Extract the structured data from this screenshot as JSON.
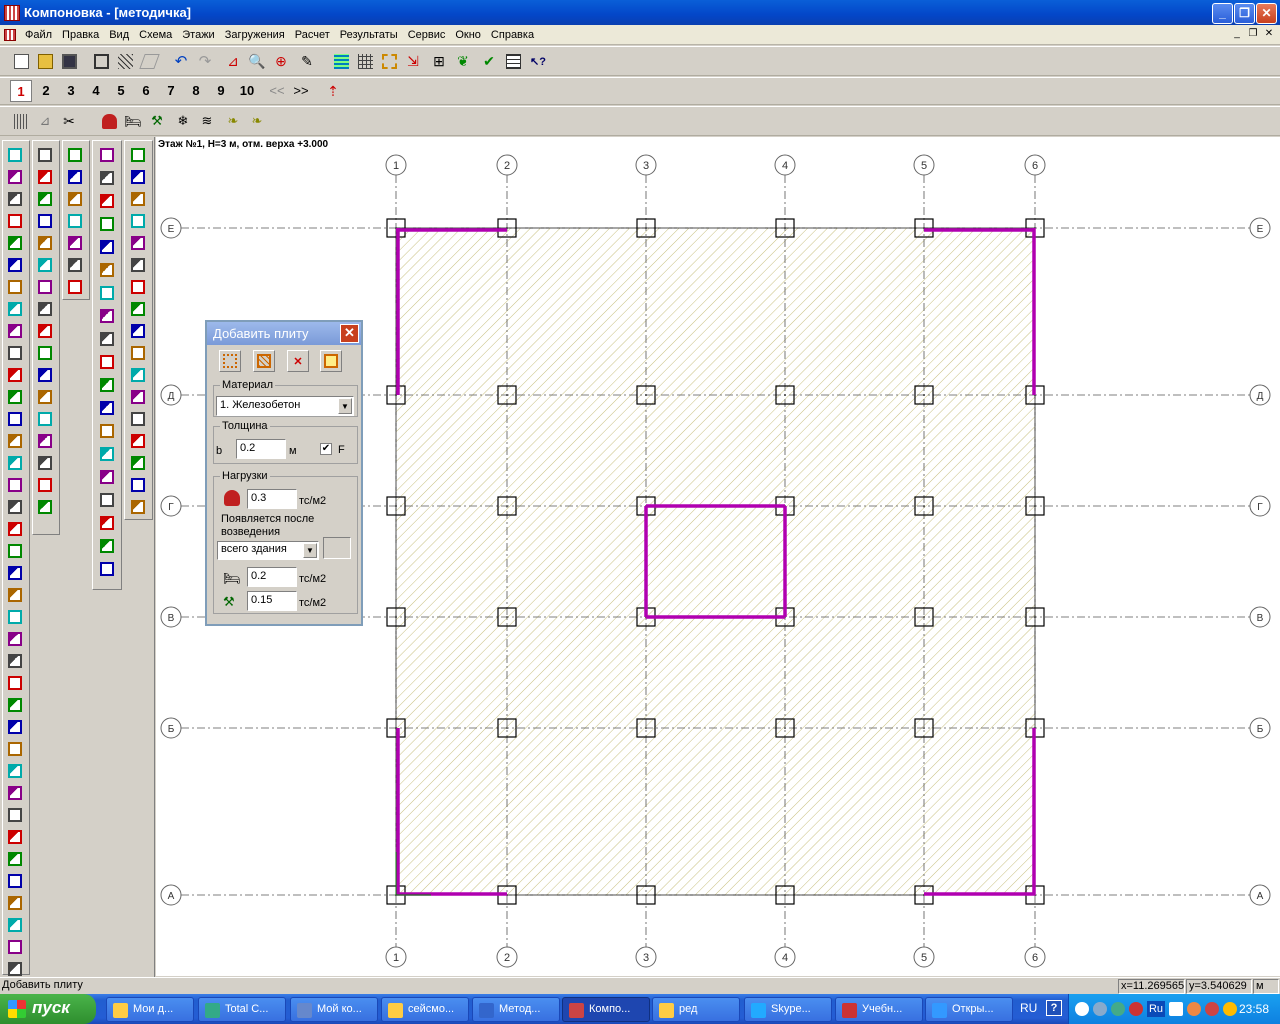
{
  "window": {
    "title": "Компоновка - [методичка]"
  },
  "menu": [
    "Файл",
    "Правка",
    "Вид",
    "Схема",
    "Этажи",
    "Загружения",
    "Расчет",
    "Результаты",
    "Сервис",
    "Окно",
    "Справка"
  ],
  "floors": {
    "items": [
      "1",
      "2",
      "3",
      "4",
      "5",
      "6",
      "7",
      "8",
      "9",
      "10"
    ],
    "prev": "<<",
    "next": ">>",
    "selected": "1"
  },
  "canvas": {
    "floor_label": "Этаж №1, H=3 м, отм. верха +3.000",
    "axes_numbers": [
      "1",
      "2",
      "3",
      "4",
      "5",
      "6"
    ],
    "axes_letters": [
      "Е",
      "Д",
      "Г",
      "В",
      "Б",
      "А"
    ],
    "slab_fill_color": "#c8c080",
    "wall_color": "#b000b0"
  },
  "dialog": {
    "title": "Добавить плиту",
    "material_label": "Материал",
    "material_value": "1. Железобетон",
    "thickness_label": "Толщина",
    "b_label": "b",
    "b_value": "0.2",
    "b_unit": "м",
    "f_label": "F",
    "f_checked": true,
    "loads_label": "Нагрузки",
    "load1_value": "0.3",
    "load1_unit": "тс/м2",
    "appears_label": "Появляется после возведения",
    "appears_value": "всего здания",
    "load2_value": "0.2",
    "load2_unit": "тс/м2",
    "load3_value": "0.15",
    "load3_unit": "тс/м2"
  },
  "status": {
    "message": "Добавить плиту",
    "x": "x=11.269565",
    "y": "y=3.540629",
    "unit": "м"
  },
  "taskbar": {
    "start": "пуск",
    "tasks": [
      "Мои д...",
      "Total C...",
      "Мой ко...",
      "сейсмо...",
      "Метод...",
      "Компо...",
      "ред",
      "Skype...",
      "Учебн...",
      "Откры..."
    ],
    "active_task": "Компо...",
    "lang": "RU",
    "help": "?",
    "tray_lang": "Ru",
    "clock": "23:58"
  }
}
